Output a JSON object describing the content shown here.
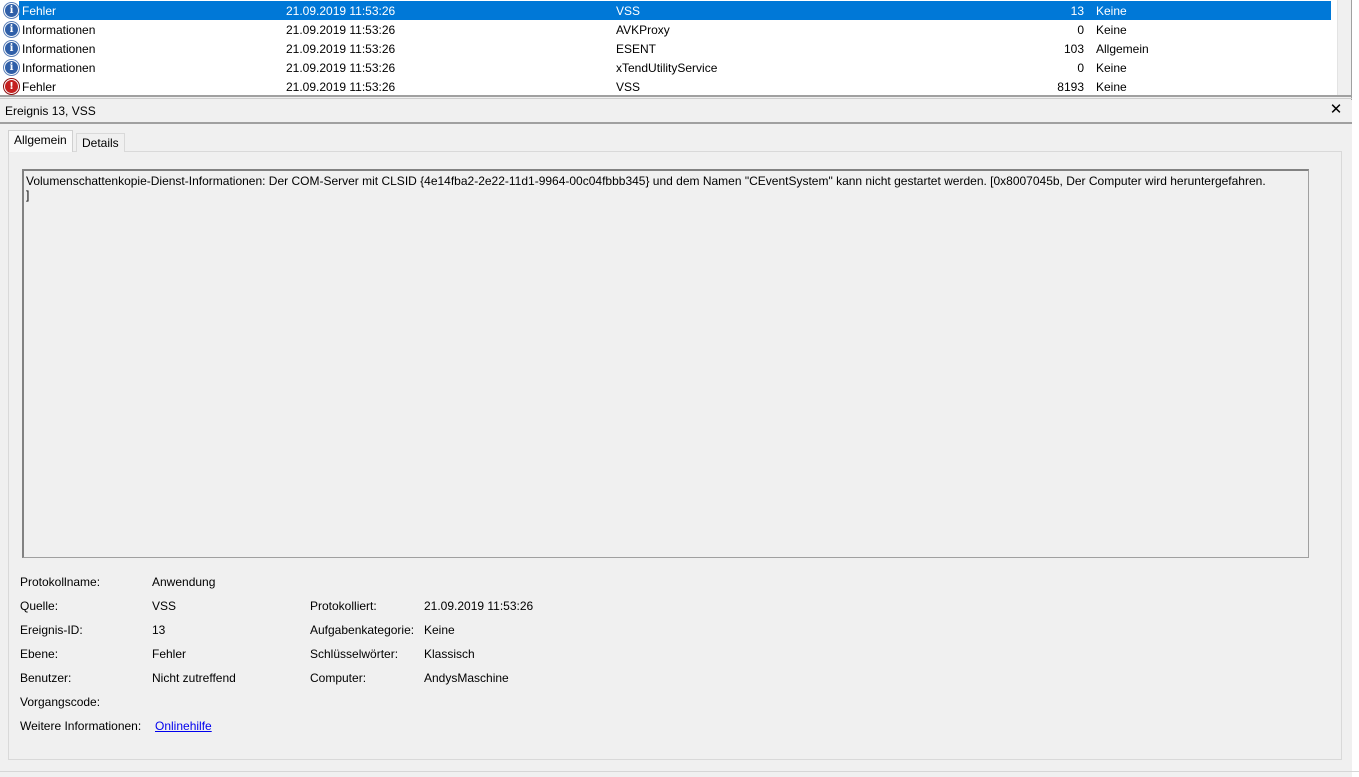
{
  "events": [
    {
      "level": "Fehler",
      "type": "error-icon",
      "date": "21.09.2019 11:53:26",
      "source": "VSS",
      "id": "13",
      "category": "Keine",
      "selected": true
    },
    {
      "level": "Informationen",
      "type": "info",
      "date": "21.09.2019 11:53:26",
      "source": "AVKProxy",
      "id": "0",
      "category": "Keine"
    },
    {
      "level": "Informationen",
      "type": "info",
      "date": "21.09.2019 11:53:26",
      "source": "ESENT",
      "id": "103",
      "category": "Allgemein"
    },
    {
      "level": "Informationen",
      "type": "info",
      "date": "21.09.2019 11:53:26",
      "source": "xTendUtilityService",
      "id": "0",
      "category": "Keine"
    },
    {
      "level": "Fehler",
      "type": "error",
      "date": "21.09.2019 11:53:26",
      "source": "VSS",
      "id": "8193",
      "category": "Keine"
    }
  ],
  "icons": {
    "info": "i",
    "error": "!",
    "close": "✕"
  },
  "detail": {
    "title": "Ereignis 13, VSS",
    "tabs": [
      "Allgemein",
      "Details"
    ],
    "message": "Volumenschattenkopie-Dienst-Informationen: Der COM-Server mit CLSID {4e14fba2-2e22-11d1-9964-00c04fbbb345} und dem Namen \"CEventSystem\" kann nicht gestartet werden. [0x8007045b, Der Computer wird heruntergefahren.\n]"
  },
  "properties": {
    "protokollname_label": "Protokollname:",
    "protokollname": "Anwendung",
    "quelle_label": "Quelle:",
    "quelle": "VSS",
    "protokolliert_label": "Protokolliert:",
    "protokolliert": "21.09.2019 11:53:26",
    "ereignis_id_label": "Ereignis-ID:",
    "ereignis_id": "13",
    "aufgabenkategorie_label": "Aufgabenkategorie:",
    "aufgabenkategorie": "Keine",
    "ebene_label": "Ebene:",
    "ebene": "Fehler",
    "schluesselwoerter_label": "Schlüsselwörter:",
    "schluesselwoerter": "Klassisch",
    "benutzer_label": "Benutzer:",
    "benutzer": "Nicht zutreffend",
    "computer_label": "Computer:",
    "computer": "AndysMaschine",
    "vorgangscode_label": "Vorgangscode:",
    "weitere_label": "Weitere Informationen:",
    "weitere_link": "Onlinehilfe"
  },
  "colors": {
    "selection": "#0078d7",
    "link": "#0000ee",
    "info_icon": "#2f5fa8",
    "error_icon": "#c42020"
  }
}
